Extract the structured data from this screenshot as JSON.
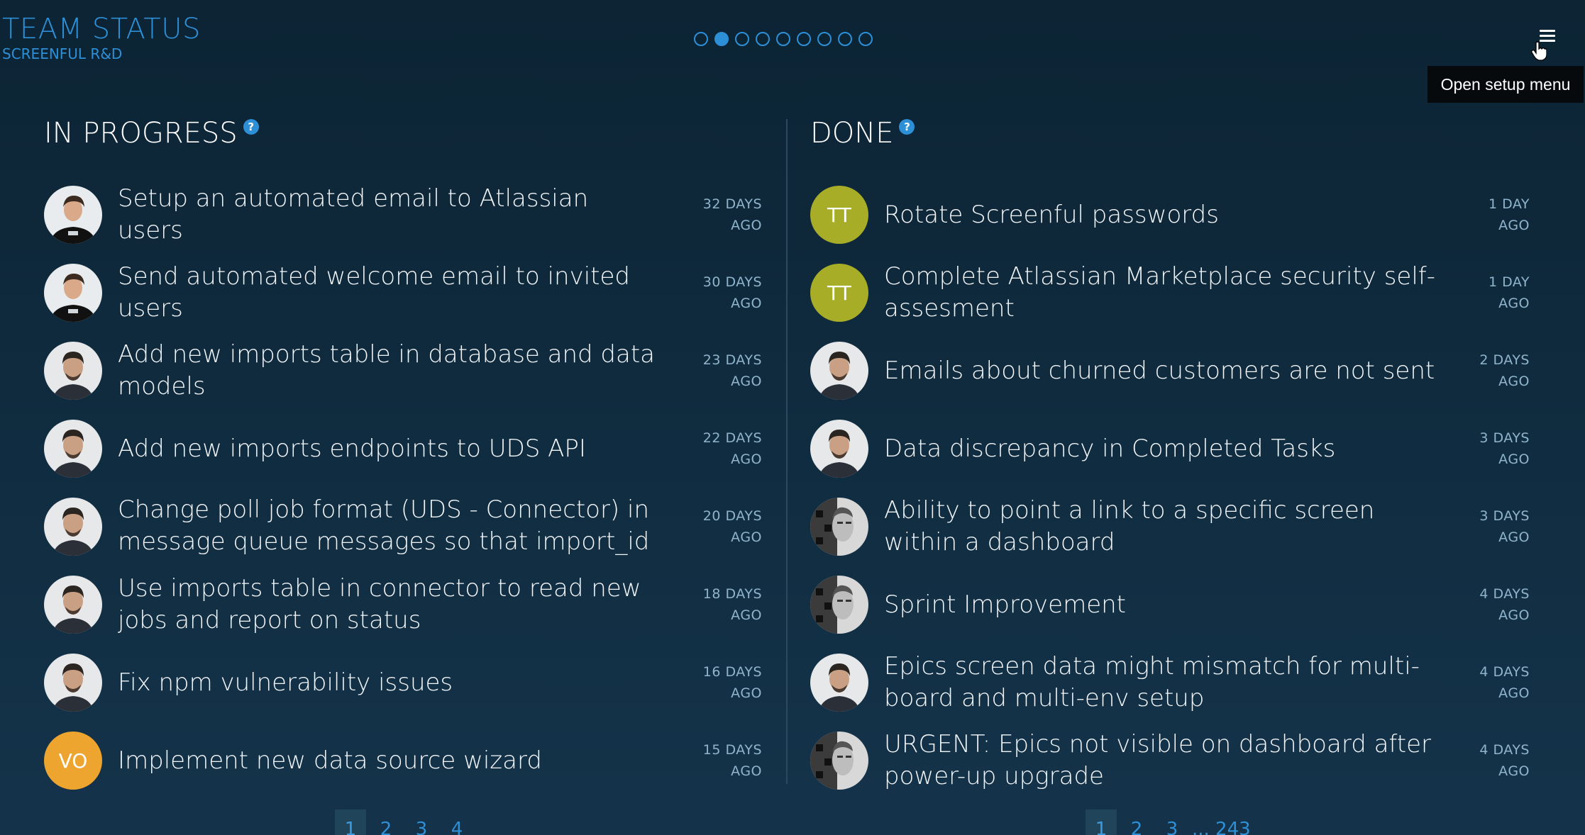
{
  "header": {
    "title": "TEAM STATUS",
    "subtitle": "SCREENFUL R&D",
    "dots_count": 9,
    "active_dot": 1,
    "tooltip": "Open setup menu"
  },
  "colors": {
    "accent": "#2d8fd6",
    "olive": "#a8ad28",
    "orange": "#eda52f"
  },
  "in_progress": {
    "title": "IN PROGRESS",
    "tasks": [
      {
        "text": "Setup an automated email to Atlassian users",
        "ago_line1": "32 DAYS",
        "ago_line2": "AGO",
        "avatar": "photo-a"
      },
      {
        "text": "Send automated welcome email to invited users",
        "ago_line1": "30 DAYS",
        "ago_line2": "AGO",
        "avatar": "photo-a"
      },
      {
        "text": "Add new imports table in database and data models",
        "ago_line1": "23 DAYS",
        "ago_line2": "AGO",
        "avatar": "photo-b"
      },
      {
        "text": "Add new imports endpoints to UDS API",
        "ago_line1": "22 DAYS",
        "ago_line2": "AGO",
        "avatar": "photo-b"
      },
      {
        "text": "Change poll job format (UDS - Connector) in message queue messages so that import_id is",
        "ago_line1": "20 DAYS",
        "ago_line2": "AGO",
        "avatar": "photo-b"
      },
      {
        "text": "Use imports table in connector to read new jobs and report on status",
        "ago_line1": "18 DAYS",
        "ago_line2": "AGO",
        "avatar": "photo-b"
      },
      {
        "text": "Fix npm vulnerability issues",
        "ago_line1": "16 DAYS",
        "ago_line2": "AGO",
        "avatar": "photo-b"
      },
      {
        "text": "Implement new data source wizard",
        "ago_line1": "15 DAYS",
        "ago_line2": "AGO",
        "avatar": "initials",
        "initials": "VO",
        "color": "#eda52f"
      }
    ],
    "pages": [
      "1",
      "2",
      "3",
      "4"
    ],
    "active_page": 0
  },
  "done": {
    "title": "DONE",
    "tasks": [
      {
        "text": "Rotate Screenful passwords",
        "ago_line1": "1 DAY",
        "ago_line2": "AGO",
        "avatar": "initials",
        "initials": "TT",
        "color": "#a8ad28"
      },
      {
        "text": "Complete Atlassian Marketplace security self-assesment",
        "ago_line1": "1 DAY",
        "ago_line2": "AGO",
        "avatar": "initials",
        "initials": "TT",
        "color": "#a8ad28"
      },
      {
        "text": "Emails about churned customers are not sent",
        "ago_line1": "2 DAYS",
        "ago_line2": "AGO",
        "avatar": "photo-b"
      },
      {
        "text": "Data discrepancy in Completed Tasks",
        "ago_line1": "3 DAYS",
        "ago_line2": "AGO",
        "avatar": "photo-b"
      },
      {
        "text": "Ability to point a link to a specific screen within a dashboard",
        "ago_line1": "3 DAYS",
        "ago_line2": "AGO",
        "avatar": "photo-c"
      },
      {
        "text": "Sprint Improvement",
        "ago_line1": "4 DAYS",
        "ago_line2": "AGO",
        "avatar": "photo-c"
      },
      {
        "text": "Epics screen data might mismatch for multi-board and multi-env setup",
        "ago_line1": "4 DAYS",
        "ago_line2": "AGO",
        "avatar": "photo-b"
      },
      {
        "text": "URGENT: Epics not visible on dashboard after power-up upgrade",
        "ago_line1": "4 DAYS",
        "ago_line2": "AGO",
        "avatar": "photo-c"
      }
    ],
    "pages": [
      "1",
      "2",
      "3",
      "... 243"
    ],
    "active_page": 0
  }
}
